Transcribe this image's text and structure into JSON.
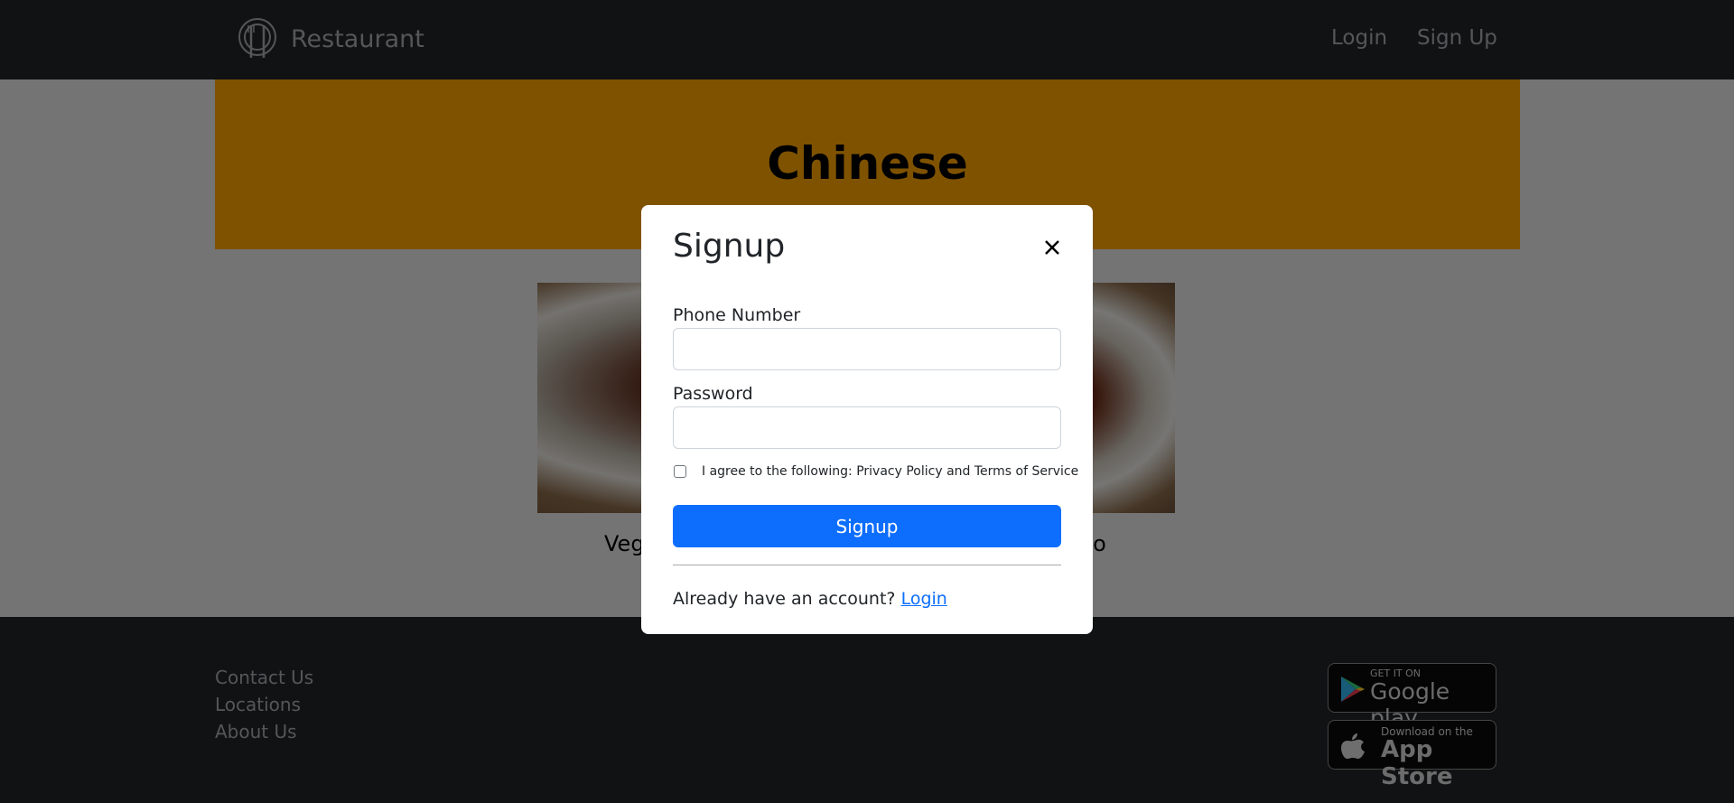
{
  "navbar": {
    "brand": "Restaurant",
    "links": [
      "Login",
      "Sign Up"
    ]
  },
  "hero": {
    "title": "Chinese"
  },
  "cards": [
    {
      "title_visible": "Veg"
    },
    {
      "title_visible": "ato"
    }
  ],
  "modal": {
    "title": "Signup",
    "phone_label": "Phone Number",
    "phone_value": "",
    "password_label": "Password",
    "password_value": "",
    "agree_text": "I agree to the following: Privacy Policy and Terms of Service",
    "submit_label": "Signup",
    "footer_text": "Already have an account?",
    "footer_link": "Login"
  },
  "footer": {
    "links": [
      "Contact Us",
      "Locations",
      "About Us"
    ],
    "badges": [
      {
        "small": "GET IT ON",
        "big": "Google play",
        "icon": "google-play-icon"
      },
      {
        "small": "Download on the",
        "big": "App Store",
        "icon": "apple-icon"
      }
    ]
  },
  "colors": {
    "navbar": "#212529",
    "hero": "#ffa500",
    "primary": "#0d6efd"
  }
}
